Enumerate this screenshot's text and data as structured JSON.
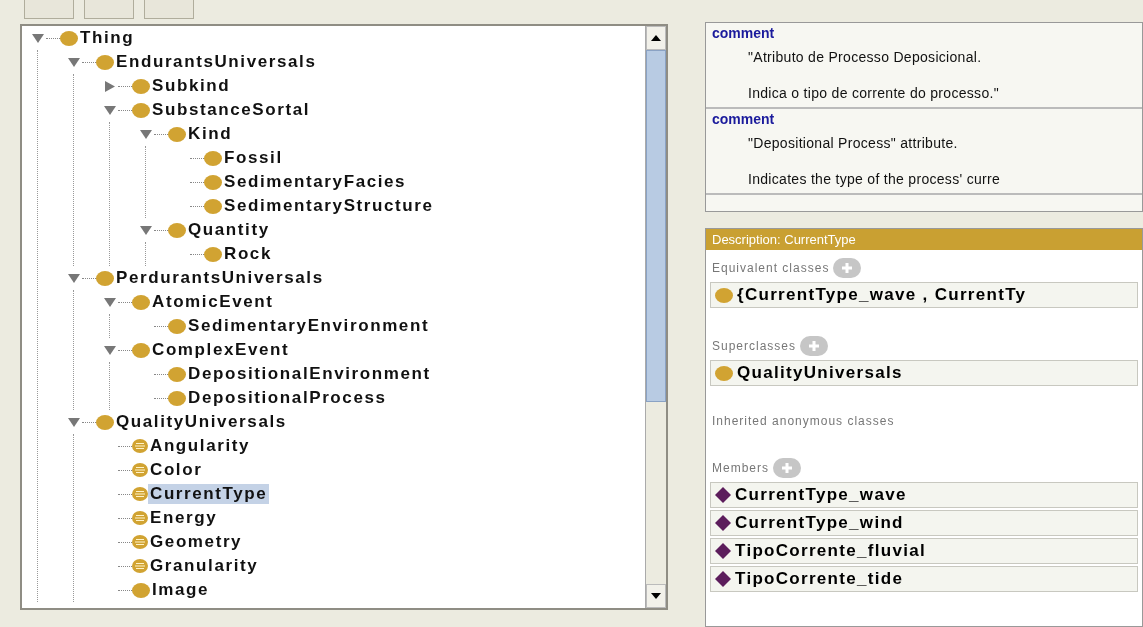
{
  "tree": {
    "nodes": [
      {
        "label": "Thing",
        "kind": "primitive",
        "expanded": true,
        "selected": false,
        "children": [
          {
            "label": "EndurantsUniversals",
            "kind": "primitive",
            "expanded": true,
            "selected": false,
            "children": [
              {
                "label": "Subkind",
                "kind": "primitive",
                "expanded": false,
                "selected": false
              },
              {
                "label": "SubstanceSortal",
                "kind": "primitive",
                "expanded": true,
                "selected": false,
                "children": [
                  {
                    "label": "Kind",
                    "kind": "primitive",
                    "expanded": true,
                    "selected": false,
                    "children": [
                      {
                        "label": "Fossil",
                        "kind": "primitive",
                        "selected": false
                      },
                      {
                        "label": "SedimentaryFacies",
                        "kind": "primitive",
                        "selected": false
                      },
                      {
                        "label": "SedimentaryStructure",
                        "kind": "primitive",
                        "selected": false
                      }
                    ]
                  },
                  {
                    "label": "Quantity",
                    "kind": "primitive",
                    "expanded": true,
                    "selected": false,
                    "children": [
                      {
                        "label": "Rock",
                        "kind": "primitive",
                        "selected": false
                      }
                    ]
                  }
                ]
              }
            ]
          },
          {
            "label": "PerdurantsUniversals",
            "kind": "primitive",
            "expanded": true,
            "selected": false,
            "children": [
              {
                "label": "AtomicEvent",
                "kind": "primitive",
                "expanded": true,
                "selected": false,
                "children": [
                  {
                    "label": "SedimentaryEnvironment",
                    "kind": "primitive",
                    "selected": false
                  }
                ]
              },
              {
                "label": "ComplexEvent",
                "kind": "primitive",
                "expanded": true,
                "selected": false,
                "children": [
                  {
                    "label": "DepositionalEnvironment",
                    "kind": "primitive",
                    "selected": false
                  },
                  {
                    "label": "DepositionalProcess",
                    "kind": "primitive",
                    "selected": false
                  }
                ]
              }
            ]
          },
          {
            "label": "QualityUniversals",
            "kind": "primitive",
            "expanded": true,
            "selected": false,
            "children": [
              {
                "label": "Angularity",
                "kind": "defined",
                "selected": false
              },
              {
                "label": "Color",
                "kind": "defined",
                "selected": false
              },
              {
                "label": "CurrentType",
                "kind": "defined",
                "selected": true
              },
              {
                "label": "Energy",
                "kind": "defined",
                "selected": false
              },
              {
                "label": "Geometry",
                "kind": "defined",
                "selected": false
              },
              {
                "label": "Granularity",
                "kind": "defined",
                "selected": false
              },
              {
                "label": "Image",
                "kind": "primitive",
                "selected": false
              }
            ]
          }
        ]
      }
    ]
  },
  "annotations": [
    {
      "property": "comment",
      "lines": [
        "\"Atributo de Processo Deposicional.",
        "Indica o tipo de corrente do processo.\""
      ]
    },
    {
      "property": "comment",
      "lines": [
        "\"Depositional Process\" attribute.",
        "Indicates the type of the process' curre"
      ]
    }
  ],
  "description": {
    "title": "Description: CurrentType",
    "sections": [
      {
        "heading": "Equivalent classes",
        "addable": true,
        "items": [
          {
            "label": "{CurrentType_wave , CurrentTy",
            "kind": "class"
          }
        ]
      },
      {
        "heading": "Superclasses",
        "addable": true,
        "items": [
          {
            "label": "QualityUniversals",
            "kind": "class"
          }
        ]
      },
      {
        "heading": "Inherited anonymous classes",
        "addable": false
      },
      {
        "heading": "Members",
        "addable": true,
        "items": [
          {
            "label": "CurrentType_wave",
            "kind": "individual"
          },
          {
            "label": "CurrentType_wind",
            "kind": "individual"
          },
          {
            "label": "TipoCorrente_fluvial",
            "kind": "individual"
          },
          {
            "label": "TipoCorrente_tide",
            "kind": "individual"
          }
        ]
      }
    ]
  }
}
